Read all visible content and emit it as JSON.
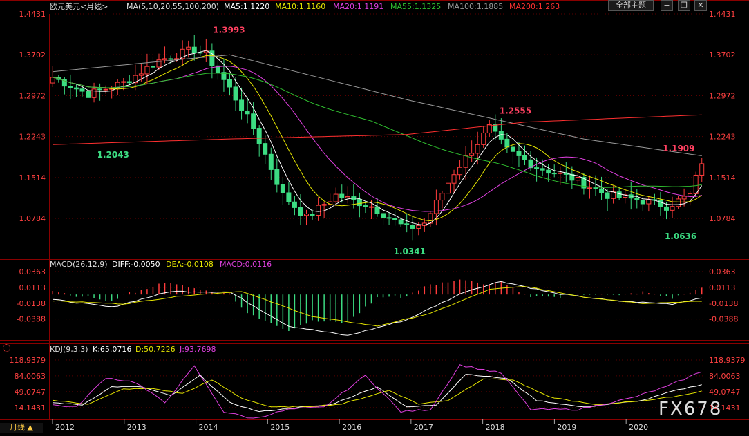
{
  "header": {
    "symbol": "欧元美元<月线>",
    "ma_label": "MA(5,10,20,55,100,200)",
    "ma5": "MA5:1.1220",
    "ma10": "MA10:1.1160",
    "ma20": "MA20:1.1191",
    "ma55": "MA55:1.1325",
    "ma100": "MA100:1.1885",
    "ma200": "MA200:1.263",
    "theme_button": "全部主题",
    "period_button": "月线 ▲"
  },
  "macd_header": {
    "title": "MACD(26,12,9)",
    "diff": "DIFF:-0.0050",
    "dea": "DEA:-0.0108",
    "macd": "MACD:0.0116"
  },
  "kdj_header": {
    "title": "KDJ(9,3,3)",
    "k": "K:65.0716",
    "d": "D:50.7226",
    "j": "J:93.7698"
  },
  "watermark": "FX678",
  "colors": {
    "up": "#ff3c3c",
    "down": "#3cdc82",
    "ma5": "#ffffff",
    "ma10": "#e6e600",
    "ma20": "#e040e0",
    "ma55": "#30c030",
    "ma100": "#999999",
    "ma200": "#ff3030",
    "axis": "#ff4040",
    "grid": "#5a0000"
  },
  "chart_data": [
    {
      "type": "candlestick",
      "title": "欧元美元<月线>",
      "x_ticks": [
        "2012",
        "2013",
        "2014",
        "2015",
        "2016",
        "2017",
        "2018",
        "2019",
        "2020"
      ],
      "y_ticks": [
        "1.4431",
        "1.3702",
        "1.2972",
        "1.2243",
        "1.1514",
        "1.0784"
      ],
      "ylim": [
        1.012,
        1.4431
      ],
      "annotations": [
        {
          "value": "1.3993",
          "color": "#ff4060"
        },
        {
          "value": "1.2043",
          "color": "#3cdc82"
        },
        {
          "value": "1.0341",
          "color": "#3cdc82"
        },
        {
          "value": "1.2555",
          "color": "#ff4060"
        },
        {
          "value": "1.1909",
          "color": "#ff4060"
        },
        {
          "value": "1.0636",
          "color": "#3cdc82"
        }
      ],
      "anchors": [
        [
          0,
          1.33
        ],
        [
          6,
          1.3
        ],
        [
          12,
          1.32
        ],
        [
          18,
          1.36
        ],
        [
          24,
          1.38
        ],
        [
          26,
          1.37
        ],
        [
          30,
          1.31
        ],
        [
          34,
          1.24
        ],
        [
          39,
          1.12
        ],
        [
          43,
          1.08
        ],
        [
          48,
          1.12
        ],
        [
          54,
          1.1
        ],
        [
          60,
          1.06
        ],
        [
          63,
          1.07
        ],
        [
          68,
          1.16
        ],
        [
          71,
          1.2
        ],
        [
          74,
          1.24
        ],
        [
          77,
          1.2
        ],
        [
          82,
          1.17
        ],
        [
          88,
          1.15
        ],
        [
          94,
          1.12
        ],
        [
          100,
          1.11
        ],
        [
          104,
          1.1
        ],
        [
          108,
          1.12
        ],
        [
          110,
          1.18
        ]
      ],
      "ma_anchors": {
        "ma100": [
          [
            0,
            1.34
          ],
          [
            30,
            1.37
          ],
          [
            60,
            1.29
          ],
          [
            90,
            1.22
          ],
          [
            110,
            1.19
          ]
        ],
        "ma200": [
          [
            0,
            1.21
          ],
          [
            30,
            1.22
          ],
          [
            60,
            1.228
          ],
          [
            80,
            1.25
          ],
          [
            110,
            1.263
          ]
        ]
      }
    },
    {
      "type": "bar",
      "title": "MACD(26,12,9)",
      "y_ticks": [
        "0.0363",
        "0.0113",
        "-0.0138",
        "-0.0388"
      ],
      "ylim": [
        -0.072,
        0.0363
      ],
      "series": [
        {
          "name": "DIFF",
          "anchors": [
            [
              0,
              -0.008
            ],
            [
              10,
              -0.02
            ],
            [
              20,
              0.005
            ],
            [
              30,
              0.004
            ],
            [
              40,
              -0.05
            ],
            [
              50,
              -0.065
            ],
            [
              60,
              -0.04
            ],
            [
              70,
              0.005
            ],
            [
              76,
              0.021
            ],
            [
              85,
              0.002
            ],
            [
              95,
              -0.01
            ],
            [
              105,
              -0.015
            ],
            [
              110,
              -0.005
            ]
          ]
        },
        {
          "name": "DEA",
          "anchors": [
            [
              0,
              -0.01
            ],
            [
              12,
              -0.015
            ],
            [
              22,
              -0.002
            ],
            [
              32,
              0.005
            ],
            [
              44,
              -0.035
            ],
            [
              55,
              -0.05
            ],
            [
              64,
              -0.03
            ],
            [
              74,
              0.008
            ],
            [
              80,
              0.013
            ],
            [
              90,
              -0.004
            ],
            [
              100,
              -0.014
            ],
            [
              110,
              -0.0108
            ]
          ]
        }
      ]
    },
    {
      "type": "line",
      "title": "KDJ(9,3,3)",
      "y_ticks": [
        "118.9379",
        "84.0063",
        "49.0747",
        "14.1431"
      ],
      "ylim": [
        -12,
        125
      ],
      "series": [
        {
          "name": "K",
          "anchors": [
            [
              0,
              25
            ],
            [
              5,
              20
            ],
            [
              10,
              60
            ],
            [
              15,
              60
            ],
            [
              20,
              40
            ],
            [
              25,
              85
            ],
            [
              30,
              25
            ],
            [
              35,
              5
            ],
            [
              42,
              15
            ],
            [
              47,
              20
            ],
            [
              55,
              60
            ],
            [
              60,
              15
            ],
            [
              65,
              20
            ],
            [
              70,
              88
            ],
            [
              77,
              78
            ],
            [
              82,
              30
            ],
            [
              90,
              15
            ],
            [
              100,
              30
            ],
            [
              105,
              50
            ],
            [
              110,
              65
            ]
          ]
        },
        {
          "name": "D",
          "anchors": [
            [
              0,
              30
            ],
            [
              6,
              22
            ],
            [
              12,
              55
            ],
            [
              17,
              56
            ],
            [
              22,
              45
            ],
            [
              27,
              75
            ],
            [
              32,
              35
            ],
            [
              37,
              15
            ],
            [
              44,
              17
            ],
            [
              49,
              22
            ],
            [
              57,
              52
            ],
            [
              62,
              22
            ],
            [
              67,
              30
            ],
            [
              73,
              78
            ],
            [
              78,
              75
            ],
            [
              84,
              38
            ],
            [
              92,
              20
            ],
            [
              102,
              32
            ],
            [
              107,
              42
            ],
            [
              110,
              50.72
            ]
          ]
        },
        {
          "name": "J",
          "anchors": [
            [
              0,
              20
            ],
            [
              4,
              15
            ],
            [
              9,
              80
            ],
            [
              14,
              70
            ],
            [
              19,
              25
            ],
            [
              24,
              105
            ],
            [
              29,
              5
            ],
            [
              34,
              -10
            ],
            [
              40,
              10
            ],
            [
              46,
              15
            ],
            [
              53,
              85
            ],
            [
              59,
              5
            ],
            [
              64,
              10
            ],
            [
              69,
              108
            ],
            [
              76,
              90
            ],
            [
              81,
              10
            ],
            [
              89,
              10
            ],
            [
              98,
              35
            ],
            [
              104,
              60
            ],
            [
              110,
              93.77
            ]
          ]
        }
      ]
    }
  ]
}
